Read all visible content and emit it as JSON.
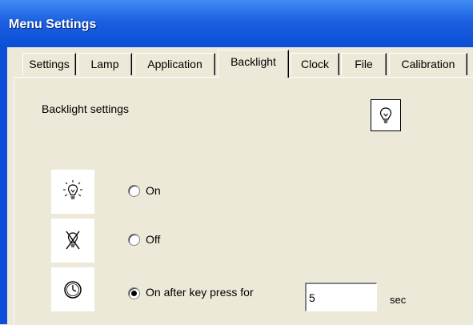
{
  "window": {
    "title": "Menu Settings"
  },
  "tabs": [
    {
      "label": "Settings",
      "active": false
    },
    {
      "label": "Lamp",
      "active": false
    },
    {
      "label": "Application",
      "active": false
    },
    {
      "label": "Backlight",
      "active": true
    },
    {
      "label": "Clock",
      "active": false
    },
    {
      "label": "File",
      "active": false
    },
    {
      "label": "Calibration",
      "active": false
    }
  ],
  "section": {
    "label": "Backlight settings",
    "icon": "lightbulb-icon"
  },
  "options": [
    {
      "label": "On",
      "icon": "lightbulb-on-icon",
      "selected": false
    },
    {
      "label": "Off",
      "icon": "lightbulb-off-icon",
      "selected": false
    },
    {
      "label": "On after key press for",
      "icon": "clock-icon",
      "selected": true
    }
  ],
  "delay": {
    "value": "5",
    "unit": "sec"
  },
  "colors": {
    "titlebar": "#0a4fd6",
    "background": "#ece9d8"
  }
}
